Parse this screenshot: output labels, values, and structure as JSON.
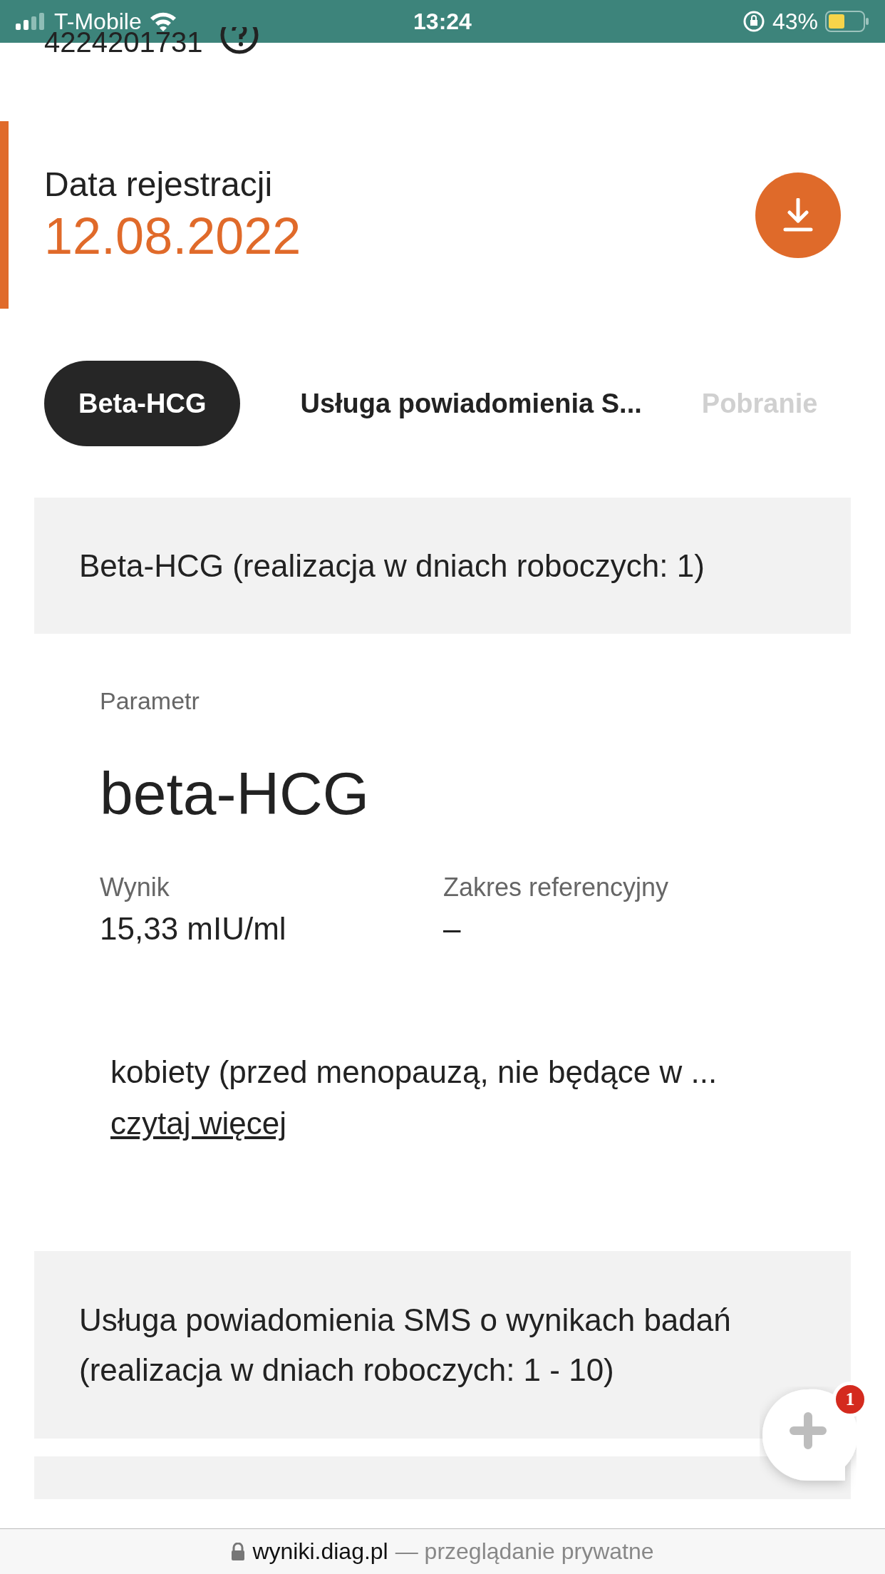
{
  "status_bar": {
    "carrier": "T-Mobile",
    "time": "13:24",
    "battery": "43%"
  },
  "patient_id": "4224201731",
  "registration": {
    "label": "Data rejestracji",
    "date": "12.08.2022"
  },
  "tabs": [
    {
      "label": "Beta-HCG",
      "selected": true
    },
    {
      "label": "Usługa powiadomienia S...",
      "selected": false
    },
    {
      "label": "Pobranie",
      "selected": false
    }
  ],
  "sections": [
    {
      "title": "Beta-HCG (realizacja w dniach roboczych: 1)",
      "parameter_label": "Parametr",
      "parameter": "beta-HCG",
      "result_label": "Wynik",
      "result": "15,33 mIU/ml",
      "range_label": "Zakres referencyjny",
      "range": "–",
      "note": "kobiety (przed menopauzą, nie będące w ...",
      "read_more": "czytaj więcej"
    },
    {
      "title": "Usługa powiadomienia SMS o wynikach badań (realizacja w dniach roboczych: 1 - 10)"
    }
  ],
  "chat_badge": "1",
  "address_bar": {
    "domain": "wyniki.diag.pl",
    "note": "— przeglądanie prywatne"
  }
}
